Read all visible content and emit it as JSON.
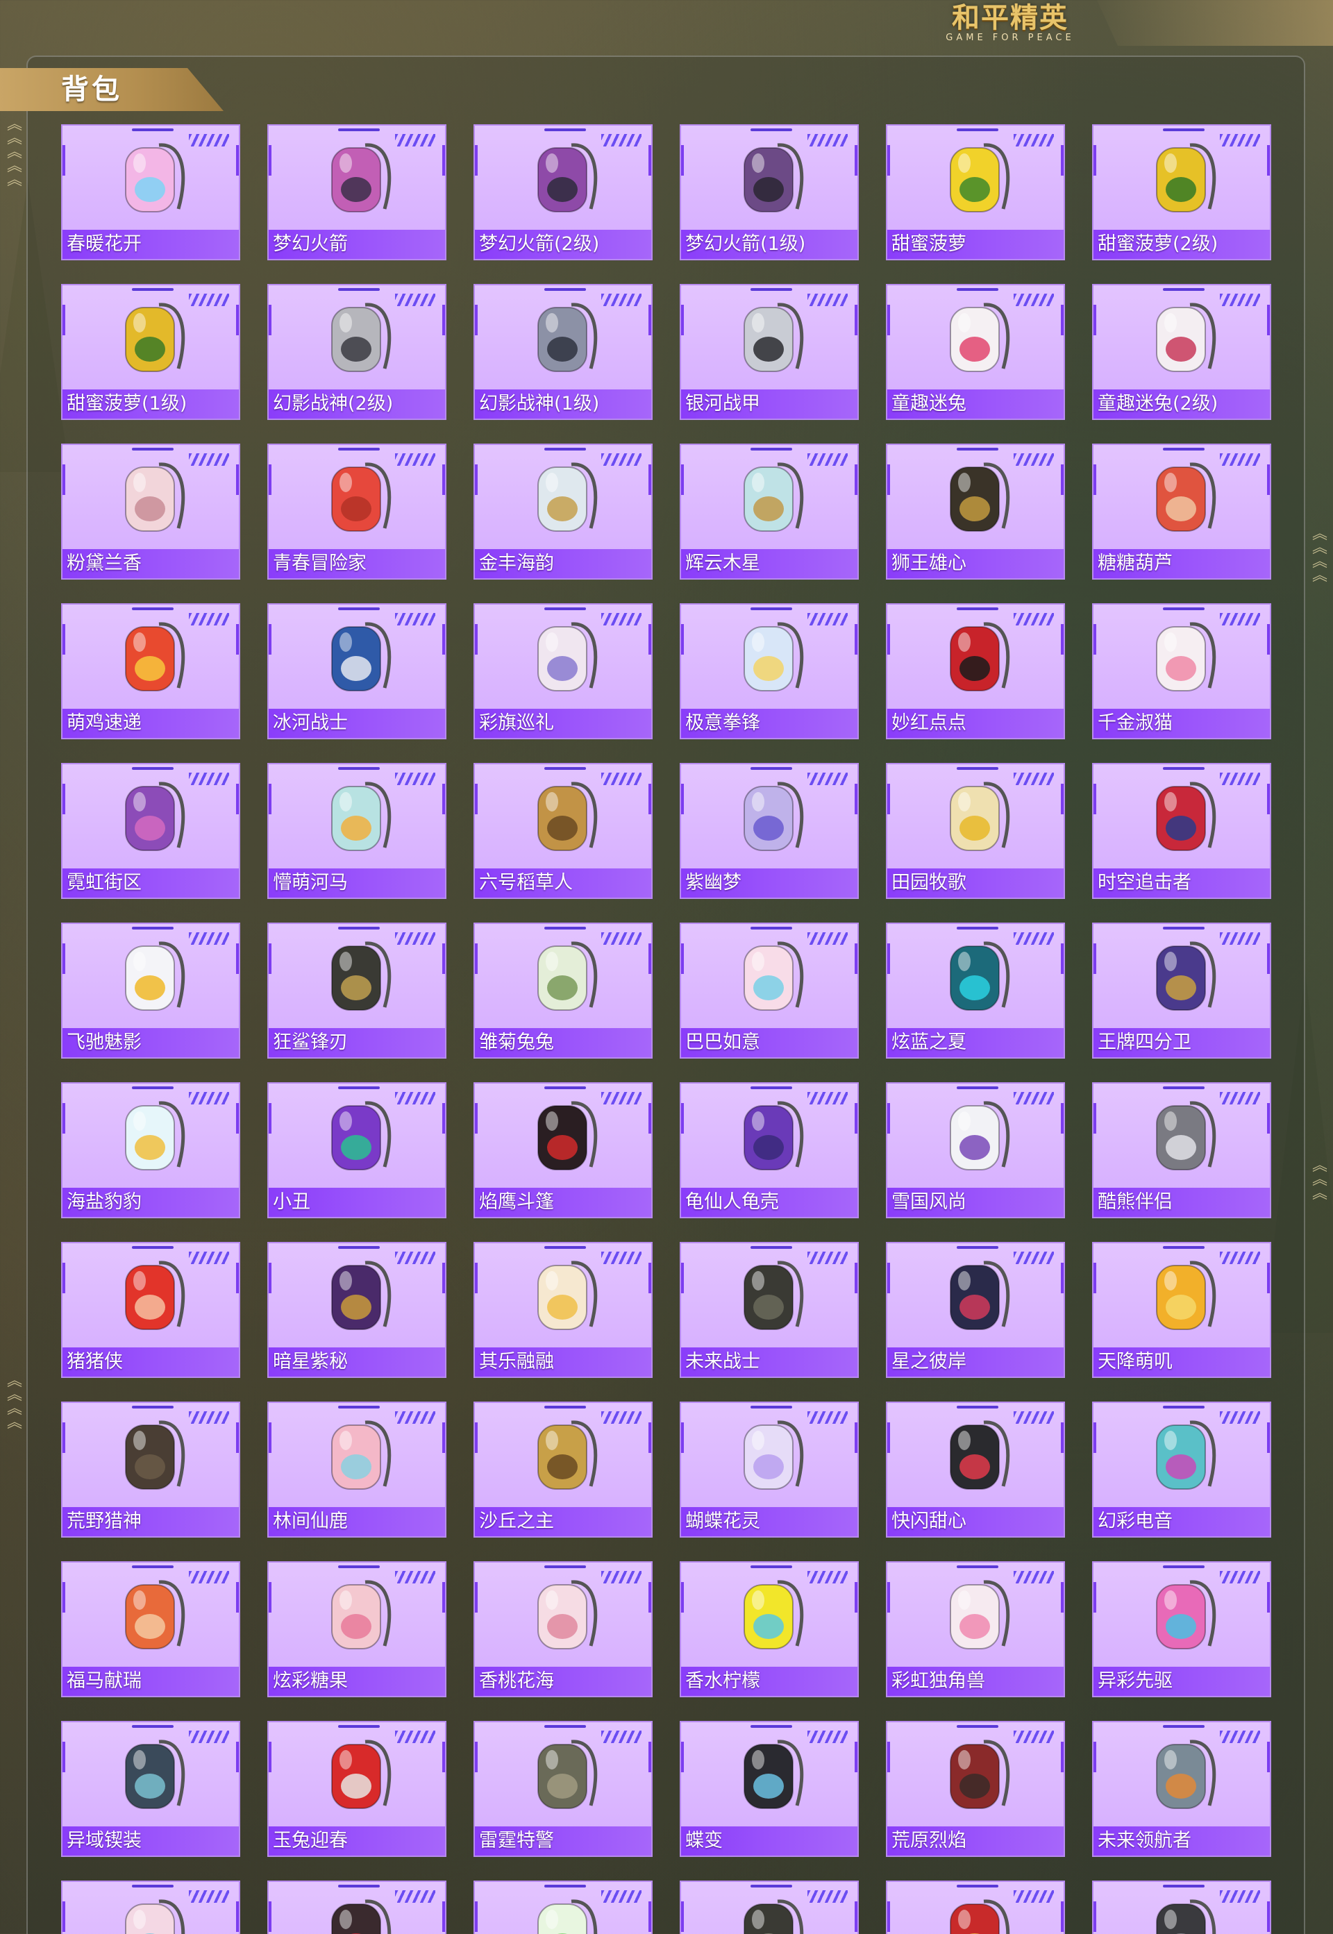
{
  "header": {
    "title": "背包",
    "logo_cn": "和平精英",
    "logo_en": "GAME FOR PEACE"
  },
  "items": [
    {
      "label": "春暖花开",
      "color": "#f3b6e6",
      "accent": "#7fd3f5"
    },
    {
      "label": "梦幻火箭",
      "color": "#c25fb5",
      "accent": "#3c2f4a"
    },
    {
      "label": "梦幻火箭(2级)",
      "color": "#8e4aa8",
      "accent": "#2e2a3c"
    },
    {
      "label": "梦幻火箭(1级)",
      "color": "#6c4a86",
      "accent": "#2a2632"
    },
    {
      "label": "甜蜜菠萝",
      "color": "#f1d22a",
      "accent": "#3f8a2a"
    },
    {
      "label": "甜蜜菠萝(2级)",
      "color": "#e6c127",
      "accent": "#357a26"
    },
    {
      "label": "甜蜜菠萝(1级)",
      "color": "#e3b92a",
      "accent": "#3c7a26"
    },
    {
      "label": "幻影战神(2级)",
      "color": "#b6b6bc",
      "accent": "#3b3b42"
    },
    {
      "label": "幻影战神(1级)",
      "color": "#8c91a6",
      "accent": "#2f3340"
    },
    {
      "label": "银河战甲",
      "color": "#c9ccd4",
      "accent": "#2b2b30"
    },
    {
      "label": "童趣迷兔",
      "color": "#f5f0f3",
      "accent": "#e2466e"
    },
    {
      "label": "童趣迷兔(2级)",
      "color": "#f4eef2",
      "accent": "#c83a5c"
    },
    {
      "label": "粉黛兰香",
      "color": "#f2d5da",
      "accent": "#c98d96"
    },
    {
      "label": "青春冒险家",
      "color": "#e6483c",
      "accent": "#b33226"
    },
    {
      "label": "金丰海韵",
      "color": "#dfe8ee",
      "accent": "#c6a04e"
    },
    {
      "label": "辉云木星",
      "color": "#bfe2e6",
      "accent": "#c19a4a"
    },
    {
      "label": "狮王雄心",
      "color": "#3a3328",
      "accent": "#c29a3e"
    },
    {
      "label": "糖糖葫芦",
      "color": "#e0543f",
      "accent": "#f0c4a0"
    },
    {
      "label": "萌鸡速递",
      "color": "#e84a2f",
      "accent": "#f7c63c"
    },
    {
      "label": "冰河战士",
      "color": "#2f5aa8",
      "accent": "#e4e8f0"
    },
    {
      "label": "彩旗巡礼",
      "color": "#f0e6f0",
      "accent": "#8a7ad0"
    },
    {
      "label": "极意拳锋",
      "color": "#d8e6f8",
      "accent": "#f3d36a"
    },
    {
      "label": "妙红点点",
      "color": "#c8232a",
      "accent": "#1b1b1b"
    },
    {
      "label": "千金淑猫",
      "color": "#f6eef2",
      "accent": "#f08aa8"
    },
    {
      "label": "霓虹街区",
      "color": "#8c4cb8",
      "accent": "#d46ac0"
    },
    {
      "label": "懵萌河马",
      "color": "#b8e2e2",
      "accent": "#f0b040"
    },
    {
      "label": "六号稻草人",
      "color": "#c29346",
      "accent": "#6b4a22"
    },
    {
      "label": "紫幽梦",
      "color": "#bfb2ea",
      "accent": "#6a5ad0"
    },
    {
      "label": "田园牧歌",
      "color": "#efe0b0",
      "accent": "#e8b82a"
    },
    {
      "label": "时空追击者",
      "color": "#c8283a",
      "accent": "#2c3a8a"
    },
    {
      "label": "飞驰魅影",
      "color": "#f4f4f8",
      "accent": "#f0b82a"
    },
    {
      "label": "狂鲨锋刃",
      "color": "#3a3a34",
      "accent": "#c0a050"
    },
    {
      "label": "雏菊兔兔",
      "color": "#e4eed8",
      "accent": "#7a9a5a"
    },
    {
      "label": "巴巴如意",
      "color": "#f8dce8",
      "accent": "#7ad0e6"
    },
    {
      "label": "炫蓝之夏",
      "color": "#1c6a7a",
      "accent": "#2ad0e0"
    },
    {
      "label": "王牌四分卫",
      "color": "#4a3a8c",
      "accent": "#c8a040"
    },
    {
      "label": "海盐豹豹",
      "color": "#e6f6fa",
      "accent": "#f0c040"
    },
    {
      "label": "小丑",
      "color": "#7a3ac8",
      "accent": "#2ac090"
    },
    {
      "label": "焰鹰斗篷",
      "color": "#2a1e22",
      "accent": "#d02a2a"
    },
    {
      "label": "龟仙人龟壳",
      "color": "#6a3ab8",
      "accent": "#3a2a7a"
    },
    {
      "label": "雪国风尚",
      "color": "#f2f2f6",
      "accent": "#7a4ab8"
    },
    {
      "label": "酷熊伴侣",
      "color": "#7a7a82",
      "accent": "#e0e0e6"
    },
    {
      "label": "猪猪侠",
      "color": "#e2342a",
      "accent": "#f6c0a0"
    },
    {
      "label": "暗星紫秘",
      "color": "#4a2a6a",
      "accent": "#c89a3a"
    },
    {
      "label": "其乐融融",
      "color": "#f6e8d0",
      "accent": "#f0c04a"
    },
    {
      "label": "未来战士",
      "color": "#3a3a34",
      "accent": "#6a6a5a"
    },
    {
      "label": "星之彼岸",
      "color": "#2a2a4a",
      "accent": "#d03a5a"
    },
    {
      "label": "天降萌叽",
      "color": "#f2b02a",
      "accent": "#f6d86a"
    },
    {
      "label": "荒野猎神",
      "color": "#4a3e34",
      "accent": "#6a5a48"
    },
    {
      "label": "林间仙鹿",
      "color": "#f4b8c8",
      "accent": "#8ad0e0"
    },
    {
      "label": "沙丘之主",
      "color": "#c8a048",
      "accent": "#6a4a22"
    },
    {
      "label": "蝴蝶花灵",
      "color": "#e6dcf8",
      "accent": "#b8a0f0"
    },
    {
      "label": "快闪甜心",
      "color": "#2a2a2e",
      "accent": "#e03a4a"
    },
    {
      "label": "幻彩电音",
      "color": "#5ac0c8",
      "accent": "#c84ab8"
    },
    {
      "label": "福马献瑞",
      "color": "#e86a3a",
      "accent": "#f4c8a0"
    },
    {
      "label": "炫彩糖果",
      "color": "#f4c8d0",
      "accent": "#e87a9a"
    },
    {
      "label": "香桃花海",
      "color": "#f6dce4",
      "accent": "#e08aa0"
    },
    {
      "label": "香水柠檬",
      "color": "#f2e62a",
      "accent": "#5ac8e0"
    },
    {
      "label": "彩虹独角兽",
      "color": "#f6eaf0",
      "accent": "#f08ab0"
    },
    {
      "label": "异彩先驱",
      "color": "#e86ab8",
      "accent": "#4ac0e0"
    },
    {
      "label": "异域锲装",
      "color": "#3a4a5a",
      "accent": "#7ac0d0"
    },
    {
      "label": "玉兔迎春",
      "color": "#d82a2a",
      "accent": "#e8e4e0"
    },
    {
      "label": "雷霆特警",
      "color": "#6a6a58",
      "accent": "#a09a80"
    },
    {
      "label": "蝶变",
      "color": "#2a2a30",
      "accent": "#6ac0e0"
    },
    {
      "label": "荒原烈焰",
      "color": "#8a2a2a",
      "accent": "#3a2a28"
    },
    {
      "label": "未来领航者",
      "color": "#7a8a96",
      "accent": "#e0883a"
    },
    {
      "label": "",
      "color": "#f4d8e4",
      "accent": "#7ac8e0"
    },
    {
      "label": "",
      "color": "#3a2a2e",
      "accent": "#d02a3a"
    },
    {
      "label": "",
      "color": "#e8f6e0",
      "accent": "#7ad06a"
    },
    {
      "label": "",
      "color": "#3a3a34",
      "accent": "#8a8a7a"
    },
    {
      "label": "",
      "color": "#c82a2a",
      "accent": "#f0c04a"
    },
    {
      "label": "",
      "color": "#3a3a3e",
      "accent": "#8a8a90"
    }
  ]
}
